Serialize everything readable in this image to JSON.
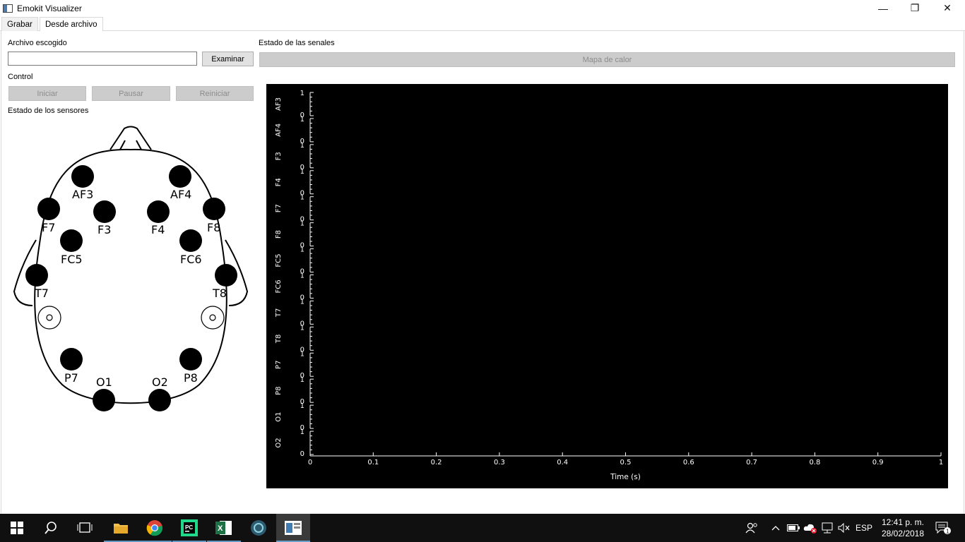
{
  "window": {
    "title": "Emokit Visualizer",
    "minimize": "—",
    "restore": "❐",
    "close": "✕"
  },
  "tabs": [
    {
      "label": "Grabar",
      "active": false
    },
    {
      "label": "Desde archivo",
      "active": true
    }
  ],
  "file": {
    "label": "Archivo escogido",
    "value": "",
    "browse_button": "Examinar"
  },
  "control": {
    "label": "Control",
    "start_button": "Iniciar",
    "pause_button": "Pausar",
    "reset_button": "Reiniciar"
  },
  "sensors": {
    "label": "Estado de los sensores",
    "electrodes": [
      "AF3",
      "AF4",
      "F3",
      "F4",
      "F7",
      "F8",
      "FC5",
      "FC6",
      "T7",
      "T8",
      "P7",
      "P8",
      "O1",
      "O2"
    ]
  },
  "signals": {
    "label": "Estado de las senales",
    "heatmap_button": "Mapa de calor"
  },
  "chart_data": {
    "type": "line",
    "channels": [
      "AF3",
      "AF4",
      "F3",
      "F4",
      "F7",
      "F8",
      "FC5",
      "FC6",
      "T7",
      "T8",
      "P7",
      "P8",
      "O1",
      "O2"
    ],
    "channel_ylim": [
      0,
      1
    ],
    "y_ticks": [
      "0",
      "1"
    ],
    "x_ticks": [
      "0",
      "0.1",
      "0.2",
      "0.3",
      "0.4",
      "0.5",
      "0.6",
      "0.7",
      "0.8",
      "0.9",
      "1"
    ],
    "xlim": [
      0,
      1
    ],
    "xlabel": "Time (s)",
    "series": [],
    "background": "#000000",
    "axis_color": "#ffffff"
  },
  "taskbar": {
    "apps": [
      "windows-start",
      "search",
      "task-view",
      "file-explorer",
      "chrome",
      "pycharm",
      "excel",
      "app-circle",
      "emokit-visualizer"
    ],
    "language": "ESP",
    "time": "12:41 p. m.",
    "date": "28/02/2018",
    "notifications": "1"
  }
}
